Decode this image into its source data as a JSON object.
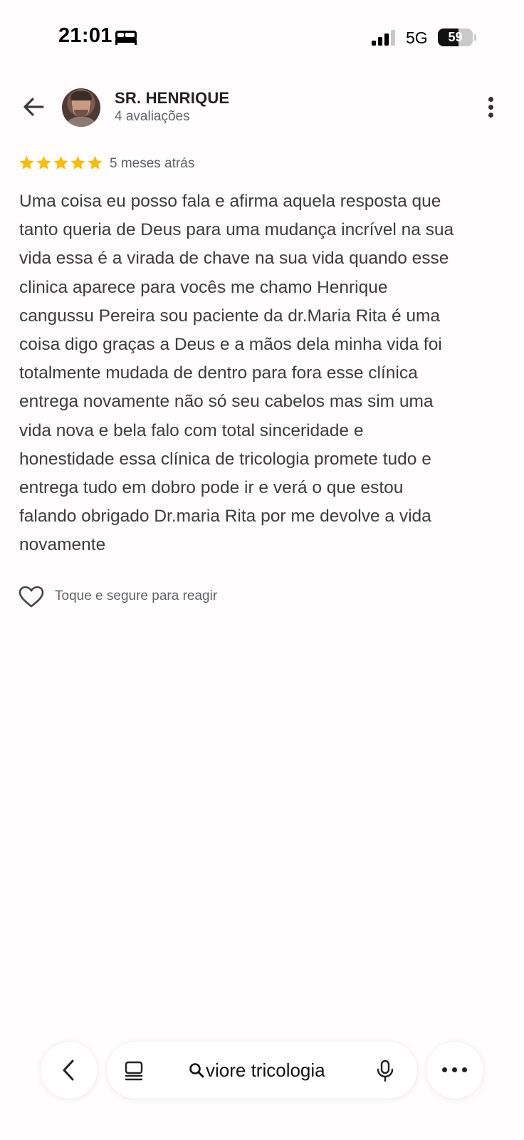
{
  "status_bar": {
    "time": "21:01",
    "network": "5G",
    "battery": "59",
    "battery_level": 0.59,
    "icons": [
      "bed-icon",
      "signal-icon",
      "battery-icon"
    ]
  },
  "header": {
    "reviewer_name": "SR. HENRIQUE",
    "review_count": "4 avaliações",
    "icons": [
      "arrow-back-icon",
      "avatar",
      "more-vertical-icon"
    ]
  },
  "review": {
    "rating": 5,
    "max_rating": 5,
    "date": "5 meses atrás",
    "text": "Uma coisa eu posso fala e afirma aquela resposta que\ntanto queria de Deus para uma mudança incrível na sua\nvida essa é a virada de chave na sua vida quando esse\nclinica aparece para vocês me chamo Henrique\ncangussu Pereira sou paciente da dr.Maria Rita é uma\ncoisa digo graças a Deus e a mãos dela minha vida foi\ntotalmente mudada de dentro para fora esse clínica\nentrega novamente não só seu cabelos mas sim uma\nvida nova e bela falo com total sinceridade e\nhonestidade essa clínica de tricologia promete tudo e\nentrega tudo em dobro pode ir e verá o que estou\nfalando obrigado Dr.maria Rita por me devolve a vida\nnovamente",
    "star_color": "#fbbc04"
  },
  "reaction": {
    "label": "Toque e segure para reagir",
    "icon": "heart-outline-icon"
  },
  "bottom_bar": {
    "search_query": "viore tricologia",
    "icons": [
      "chevron-left-icon",
      "tabs-icon",
      "search-icon",
      "mic-icon",
      "more-horizontal-icon"
    ]
  }
}
